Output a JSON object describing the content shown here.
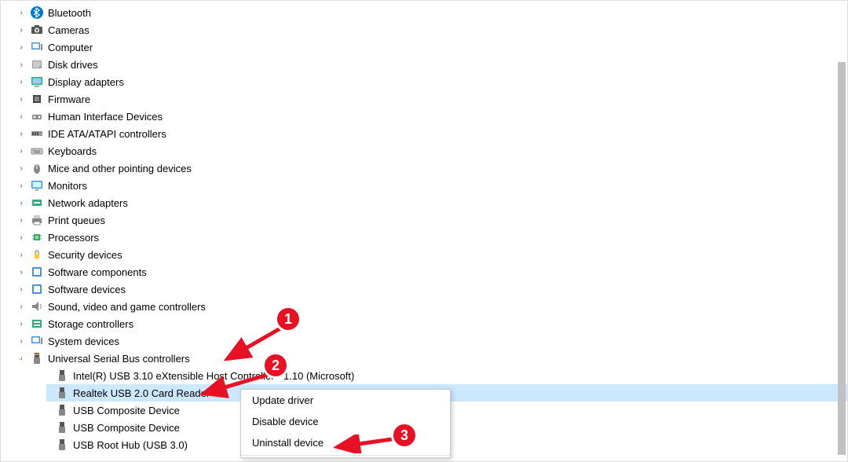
{
  "categories": [
    {
      "label": "Bluetooth",
      "iconKey": "bluetooth"
    },
    {
      "label": "Cameras",
      "iconKey": "camera"
    },
    {
      "label": "Computer",
      "iconKey": "computer"
    },
    {
      "label": "Disk drives",
      "iconKey": "disk"
    },
    {
      "label": "Display adapters",
      "iconKey": "display"
    },
    {
      "label": "Firmware",
      "iconKey": "firmware"
    },
    {
      "label": "Human Interface Devices",
      "iconKey": "hid"
    },
    {
      "label": "IDE ATA/ATAPI controllers",
      "iconKey": "ide"
    },
    {
      "label": "Keyboards",
      "iconKey": "keyboard"
    },
    {
      "label": "Mice and other pointing devices",
      "iconKey": "mouse"
    },
    {
      "label": "Monitors",
      "iconKey": "monitor"
    },
    {
      "label": "Network adapters",
      "iconKey": "network"
    },
    {
      "label": "Print queues",
      "iconKey": "printer"
    },
    {
      "label": "Processors",
      "iconKey": "processor"
    },
    {
      "label": "Security devices",
      "iconKey": "security"
    },
    {
      "label": "Software components",
      "iconKey": "software"
    },
    {
      "label": "Software devices",
      "iconKey": "software"
    },
    {
      "label": "Sound, video and game controllers",
      "iconKey": "sound"
    },
    {
      "label": "Storage controllers",
      "iconKey": "storage"
    },
    {
      "label": "System devices",
      "iconKey": "system"
    }
  ],
  "usb_category": {
    "label": "Universal Serial Bus controllers",
    "iconKey": "usb",
    "devices": [
      {
        "label": "Intel(R) USB 3.10 eXtensible Host Controller - 1.10 (Microsoft)",
        "selected": false
      },
      {
        "label": "Realtek USB 2.0 Card Reader",
        "selected": true
      },
      {
        "label": "USB Composite Device",
        "selected": false
      },
      {
        "label": "USB Composite Device",
        "selected": false
      },
      {
        "label": "USB Root Hub (USB 3.0)",
        "selected": false
      }
    ]
  },
  "context_menu": {
    "items": [
      "Update driver",
      "Disable device",
      "Uninstall device"
    ]
  },
  "annotations": {
    "b1": "1",
    "b2": "2",
    "b3": "3"
  }
}
